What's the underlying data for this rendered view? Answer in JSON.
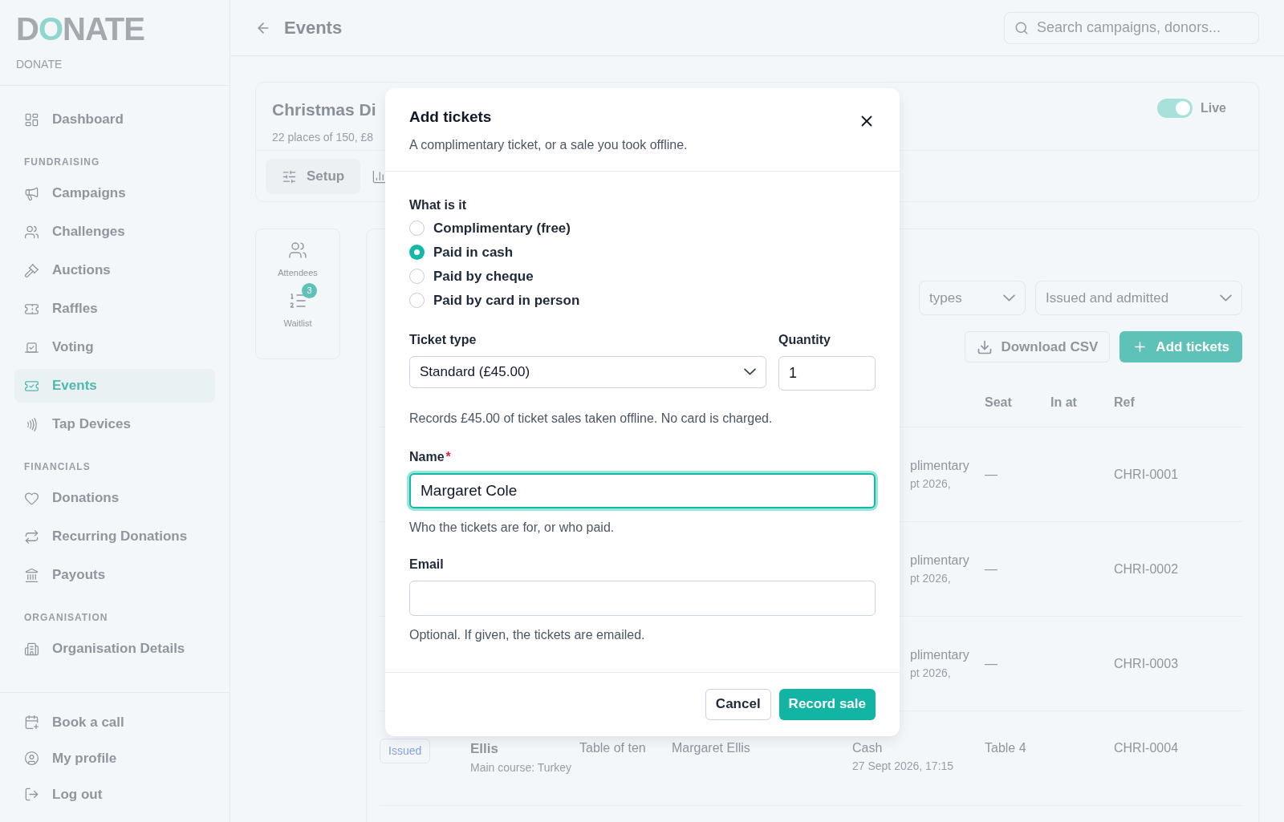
{
  "brand": {
    "logo": [
      {
        "text": "D",
        "accent": false
      },
      {
        "text": "O",
        "accent": true
      },
      {
        "text": "NATE",
        "accent": false
      }
    ],
    "subtitle": "DONATE"
  },
  "sidebar": {
    "sections": [
      {
        "items": [
          {
            "label": "Dashboard",
            "selected": false
          }
        ]
      },
      {
        "heading": "FUNDRAISING",
        "items": [
          {
            "label": "Campaigns",
            "selected": false
          },
          {
            "label": "Challenges",
            "selected": false
          },
          {
            "label": "Auctions",
            "selected": false
          },
          {
            "label": "Raffles",
            "selected": false
          },
          {
            "label": "Voting",
            "selected": false
          },
          {
            "label": "Events",
            "selected": true
          },
          {
            "label": "Tap Devices",
            "selected": false
          }
        ]
      },
      {
        "heading": "FINANCIALS",
        "items": [
          {
            "label": "Donations",
            "selected": false
          },
          {
            "label": "Recurring Donations",
            "selected": false
          },
          {
            "label": "Payouts",
            "selected": false
          }
        ]
      },
      {
        "heading": "ORGANISATION",
        "items": [
          {
            "label": "Organisation Details",
            "selected": false
          }
        ]
      }
    ],
    "footer": [
      {
        "label": "Book a call"
      },
      {
        "label": "My profile"
      },
      {
        "label": "Log out"
      }
    ]
  },
  "topbar": {
    "title": "Events",
    "search": {
      "placeholder": "Search campaigns, donors..."
    }
  },
  "event": {
    "title": "Christmas Di",
    "summary": "22 places of 150, £8",
    "live": {
      "label": "Live",
      "on": true
    },
    "tabs": [
      {
        "label": "Setup",
        "selected": false
      }
    ]
  },
  "side_nav": [
    {
      "label": "Attendees"
    },
    {
      "label": "Waitlist",
      "badge": "3"
    }
  ],
  "attendees": {
    "filters": [
      {
        "value": "types"
      },
      {
        "value": "Issued and admitted"
      }
    ],
    "buttons": [
      {
        "kind": "secondary",
        "label": "Download CSV"
      },
      {
        "kind": "primary",
        "label": "Add tickets"
      }
    ],
    "columns": [
      "Seat",
      "In at",
      "Ref"
    ],
    "rows": [
      {
        "paid": "plimentary",
        "paid_detail": "pt 2026,",
        "seat": "—",
        "ref": "CHRI-0001"
      },
      {
        "paid": "plimentary",
        "paid_detail": "pt 2026,",
        "seat": "—",
        "ref": "CHRI-0002"
      },
      {
        "paid": "plimentary",
        "paid_detail": "pt 2026,",
        "seat": "—",
        "ref": "CHRI-0003"
      },
      {
        "status": "Issued",
        "name": "Ellis",
        "name_detail": "Main course: Turkey",
        "ticket": "Table of ten",
        "buyer": "Margaret Ellis",
        "paid": "Cash",
        "paid_detail": "27 Sept 2026, 17:15",
        "seat": "Table 4",
        "ref": "CHRI-0004"
      }
    ]
  },
  "dialog": {
    "title": "Add tickets",
    "subtitle": "A complimentary ticket, or a sale you took offline.",
    "what_label": "What is it",
    "options": [
      {
        "label": "Complimentary (free)",
        "selected": false
      },
      {
        "label": "Paid in cash",
        "selected": true
      },
      {
        "label": "Paid by cheque",
        "selected": false
      },
      {
        "label": "Paid by card in person",
        "selected": false
      }
    ],
    "ticket_type": {
      "label": "Ticket type",
      "value": "Standard (£45.00)"
    },
    "quantity": {
      "label": "Quantity",
      "value": "1"
    },
    "note": "Records £45.00 of ticket sales taken offline. No card is charged.",
    "name": {
      "label": "Name",
      "required_mark": "*",
      "value": "Margaret Cole",
      "focused": true,
      "help": "Who the tickets are for, or who paid."
    },
    "email": {
      "label": "Email",
      "focused": false,
      "help": "Optional. If given, the tickets are emailed."
    },
    "buttons": [
      {
        "kind": "secondary",
        "label": "Cancel"
      },
      {
        "kind": "primary",
        "label": "Record sale"
      }
    ]
  }
}
